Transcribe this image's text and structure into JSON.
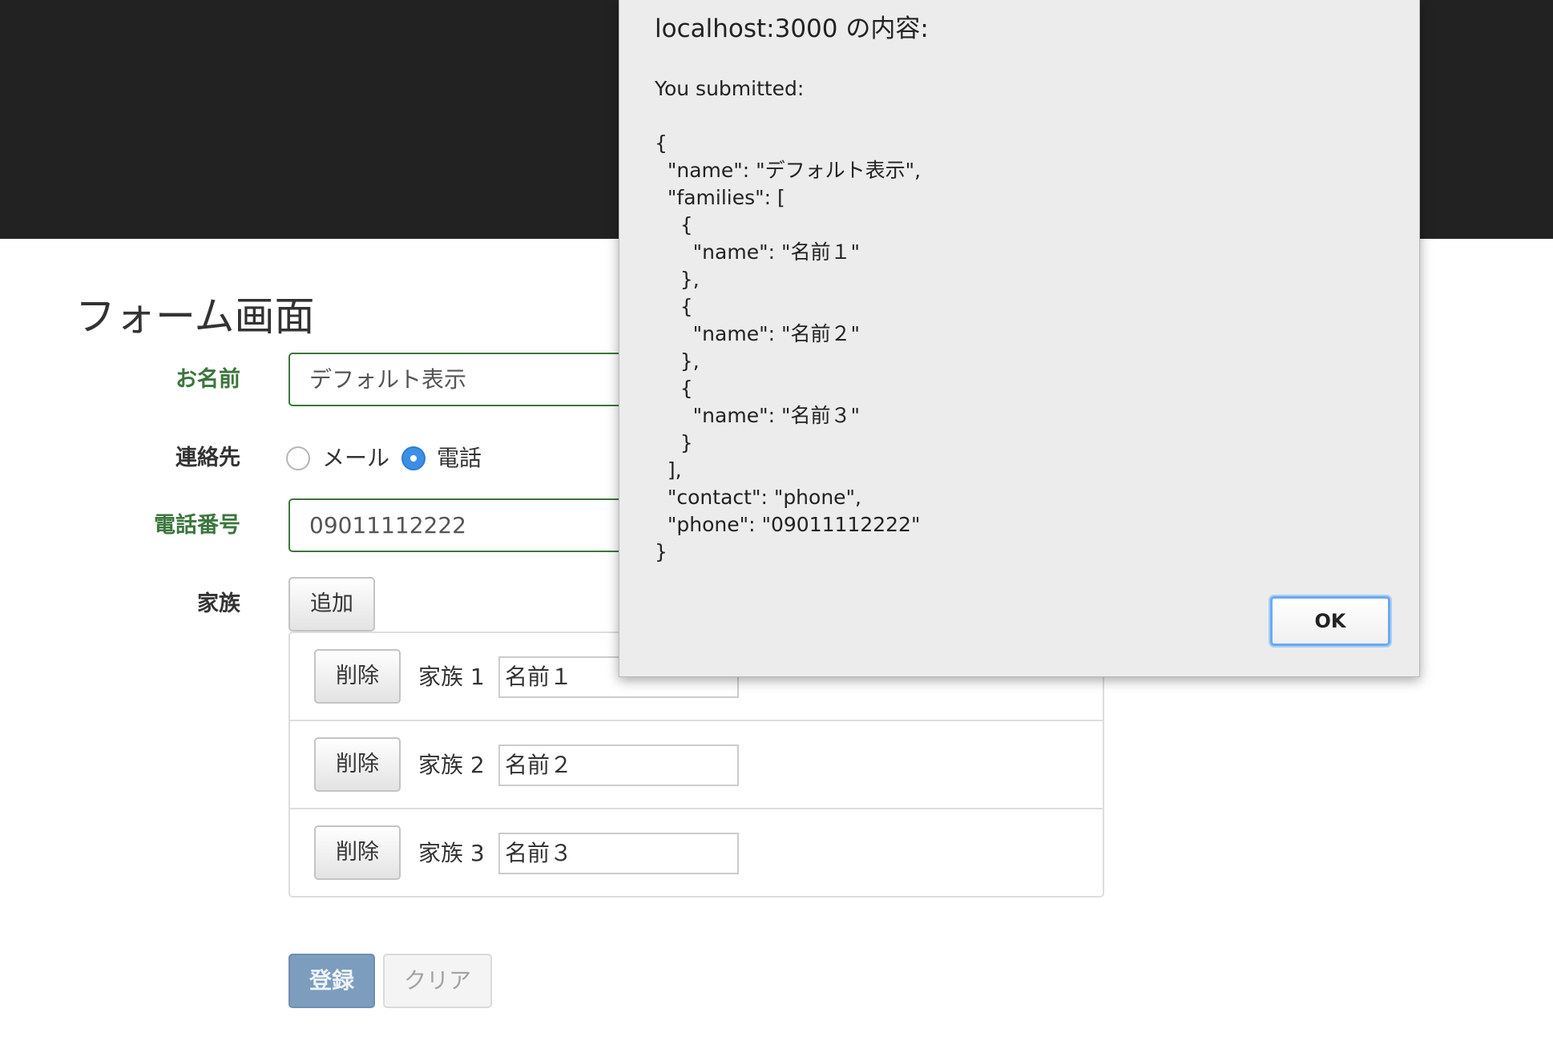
{
  "form": {
    "title": "フォーム画面",
    "name_label": "お名前",
    "name_value": "デフォルト表示",
    "contact_label": "連絡先",
    "contact_options": [
      "メール",
      "電話"
    ],
    "contact_selected": "電話",
    "phone_label": "電話番号",
    "phone_value": "09011112222",
    "family_label": "家族",
    "add_button": "追加",
    "families": [
      {
        "delete": "削除",
        "label": "家族 1",
        "value": "名前１"
      },
      {
        "delete": "削除",
        "label": "家族 2",
        "value": "名前２"
      },
      {
        "delete": "削除",
        "label": "家族 3",
        "value": "名前３"
      }
    ],
    "submit_button": "登録",
    "clear_button": "クリア"
  },
  "dialog": {
    "title": "localhost:3000 の内容:",
    "message": "You submitted:\n\n{\n  \"name\": \"デフォルト表示\",\n  \"families\": [\n    {\n      \"name\": \"名前１\"\n    },\n    {\n      \"name\": \"名前２\"\n    },\n    {\n      \"name\": \"名前３\"\n    }\n  ],\n  \"contact\": \"phone\",\n  \"phone\": \"09011112222\"\n}",
    "ok_button": "OK"
  },
  "colors": {
    "header_bg": "#222222",
    "valid_green": "#3c763d",
    "radio_blue": "#3d8fe5",
    "submit_blue": "#7c9dbd"
  }
}
